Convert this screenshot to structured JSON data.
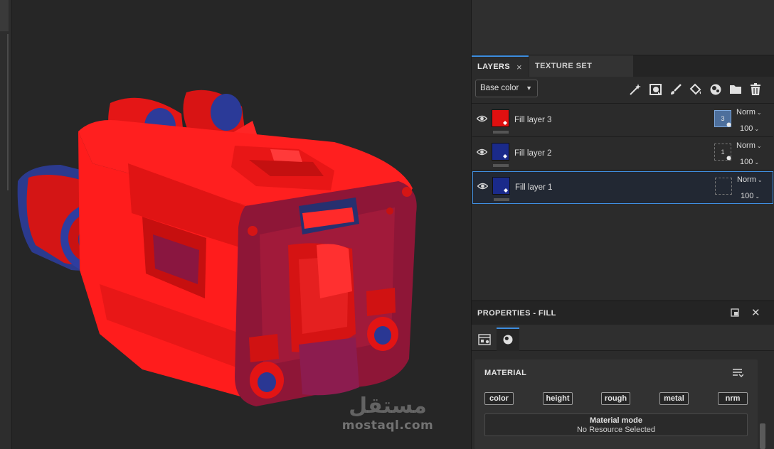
{
  "colors": {
    "accent": "#3e8ee0",
    "fill_layer_3": "#e01010",
    "fill_layer_2": "#1a2a8a",
    "fill_layer_1": "#1a2a8a",
    "model_red": "#ff1a1a",
    "model_blue": "#2b3a8e"
  },
  "layers_panel": {
    "tabs": [
      {
        "label": "LAYERS",
        "active": true
      },
      {
        "label": "TEXTURE SET SETTINGS",
        "active": false
      }
    ],
    "close_icon": "×",
    "channel_dropdown": {
      "value": "Base color",
      "icon": "chevron-down-icon"
    },
    "toolbar_icons": [
      "magic-wand-icon",
      "mask-icon",
      "brush-icon",
      "fill-bucket-icon",
      "smart-material-icon",
      "folder-icon",
      "trash-icon"
    ],
    "layers": [
      {
        "name": "Fill layer 3",
        "visible": true,
        "blend": "Norm",
        "opacity": "100",
        "mask_label": "3",
        "selected": false
      },
      {
        "name": "Fill layer 2",
        "visible": true,
        "blend": "Norm",
        "opacity": "100",
        "mask_label": "1",
        "selected": false
      },
      {
        "name": "Fill layer 1",
        "visible": true,
        "blend": "Norm",
        "opacity": "100",
        "mask_label": "",
        "selected": true
      }
    ]
  },
  "properties_panel": {
    "title": "PROPERTIES - FILL",
    "tabs": [
      "parameters-icon",
      "material-icon"
    ],
    "material": {
      "title": "MATERIAL",
      "channels": [
        "color",
        "height",
        "rough",
        "metal",
        "nrm"
      ],
      "mode_title": "Material mode",
      "mode_status": "No Resource Selected"
    }
  },
  "watermark": {
    "arabic": "مستقل",
    "latin": "mostaql.com"
  }
}
